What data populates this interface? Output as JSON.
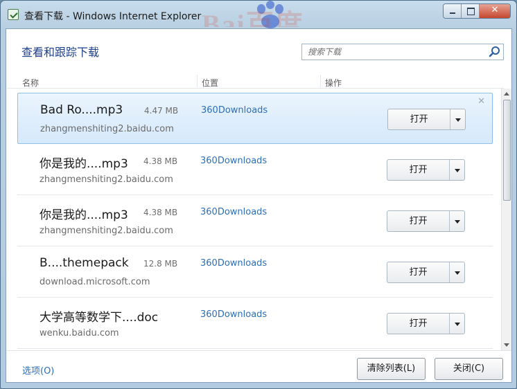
{
  "window": {
    "title": "查看下载 - Windows Internet Explorer",
    "background_logo_text": "Bai百度"
  },
  "header": {
    "title": "查看和跟踪下载",
    "search": {
      "placeholder": "搜索下载",
      "value": ""
    }
  },
  "columns": {
    "name": "名称",
    "location": "位置",
    "action": "操作"
  },
  "downloads": [
    {
      "name": "Bad Ro....mp3",
      "size": "4.47 MB",
      "source": "zhangmenshiting2.baidu.com",
      "location": "360Downloads",
      "action": "打开",
      "selected": true
    },
    {
      "name": "你是我的....mp3",
      "size": "4.38 MB",
      "source": "zhangmenshiting2.baidu.com",
      "location": "360Downloads",
      "action": "打开",
      "selected": false
    },
    {
      "name": "你是我的....mp3",
      "size": "4.38 MB",
      "source": "zhangmenshiting2.baidu.com",
      "location": "360Downloads",
      "action": "打开",
      "selected": false
    },
    {
      "name": "B....themepack",
      "size": "12.8 MB",
      "source": "download.microsoft.com",
      "location": "360Downloads",
      "action": "打开",
      "selected": false
    },
    {
      "name": "大学高等数学下....doc",
      "size": "",
      "source": "wenku.baidu.com",
      "location": "360Downloads",
      "action": "打开",
      "selected": false
    }
  ],
  "footer": {
    "options": "选项(O)",
    "clear_list": "清除列表(L)",
    "close": "关闭(C)"
  },
  "colors": {
    "accent_link": "#2c6fb7",
    "heading": "#1e3f8a",
    "selected_row": "#d6e9fb",
    "close_button": "#c6472f"
  },
  "icons": [
    "ie-download-icon",
    "minimize-icon",
    "maximize-icon",
    "close-icon",
    "search-icon",
    "dropdown-arrow-icon",
    "remove-item-icon"
  ]
}
